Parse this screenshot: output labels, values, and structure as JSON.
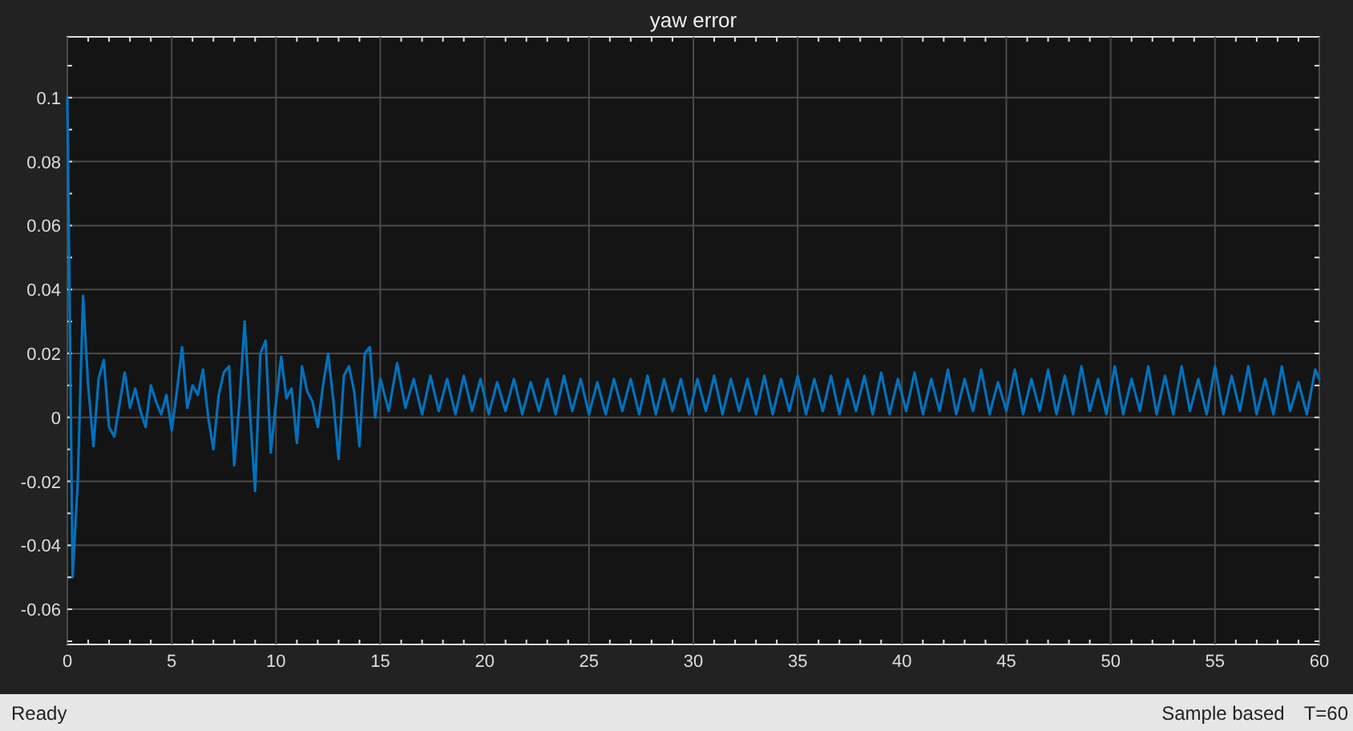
{
  "chart_data": {
    "type": "line",
    "title": "yaw error",
    "grid": true,
    "xlim": [
      0,
      60
    ],
    "ylim": [
      -0.071,
      0.119
    ],
    "xticks": [
      0,
      5,
      10,
      15,
      20,
      25,
      30,
      35,
      40,
      45,
      50,
      55,
      60
    ],
    "yticks": [
      -0.06,
      -0.04,
      -0.02,
      0,
      0.02,
      0.04,
      0.06,
      0.08,
      0.1
    ],
    "x": [
      0,
      0.25,
      0.5,
      0.75,
      1,
      1.25,
      1.5,
      1.75,
      2,
      2.25,
      2.5,
      2.75,
      3,
      3.25,
      3.5,
      3.75,
      4,
      4.25,
      4.5,
      4.75,
      5,
      5.25,
      5.5,
      5.75,
      6,
      6.25,
      6.5,
      6.75,
      7,
      7.25,
      7.5,
      7.75,
      8,
      8.25,
      8.5,
      8.75,
      9,
      9.25,
      9.5,
      9.75,
      10,
      10.25,
      10.5,
      10.75,
      11,
      11.25,
      11.5,
      11.75,
      12,
      12.25,
      12.5,
      12.75,
      13,
      13.25,
      13.5,
      13.75,
      14,
      14.25,
      14.5,
      14.75,
      15,
      15.4,
      15.8,
      16.2,
      16.6,
      17,
      17.4,
      17.8,
      18.2,
      18.6,
      19,
      19.4,
      19.8,
      20.2,
      20.6,
      21,
      21.4,
      21.8,
      22.2,
      22.6,
      23,
      23.4,
      23.8,
      24.2,
      24.6,
      25,
      25.4,
      25.8,
      26.2,
      26.6,
      27,
      27.4,
      27.8,
      28.2,
      28.6,
      29,
      29.4,
      29.8,
      30.2,
      30.6,
      31,
      31.4,
      31.8,
      32.2,
      32.6,
      33,
      33.4,
      33.8,
      34.2,
      34.6,
      35,
      35.4,
      35.8,
      36.2,
      36.6,
      37,
      37.4,
      37.8,
      38.2,
      38.6,
      39,
      39.4,
      39.8,
      40.2,
      40.6,
      41,
      41.4,
      41.8,
      42.2,
      42.6,
      43,
      43.4,
      43.8,
      44.2,
      44.6,
      45,
      45.4,
      45.8,
      46.2,
      46.6,
      47,
      47.4,
      47.8,
      48.2,
      48.6,
      49,
      49.4,
      49.8,
      50.2,
      50.6,
      51,
      51.4,
      51.8,
      52.2,
      52.6,
      53,
      53.4,
      53.8,
      54.2,
      54.6,
      55,
      55.4,
      55.8,
      56.2,
      56.6,
      57,
      57.4,
      57.8,
      58.2,
      58.6,
      59,
      59.4,
      59.8,
      60
    ],
    "series": [
      {
        "color": "#0072bd",
        "values": [
          0.1,
          -0.05,
          -0.02,
          0.038,
          0.01,
          -0.009,
          0.012,
          0.018,
          -0.003,
          -0.006,
          0.004,
          0.014,
          0.003,
          0.009,
          0.002,
          -0.003,
          0.01,
          0.005,
          0.001,
          0.007,
          -0.004,
          0.008,
          0.022,
          0.003,
          0.01,
          0.007,
          0.015,
          0,
          -0.01,
          0.007,
          0.014,
          0.016,
          -0.015,
          0.005,
          0.03,
          0.002,
          -0.023,
          0.02,
          0.024,
          -0.011,
          0.005,
          0.019,
          0.006,
          0.009,
          -0.008,
          0.016,
          0.008,
          0.005,
          -0.003,
          0.01,
          0.02,
          0.005,
          -0.013,
          0.013,
          0.016,
          0.008,
          -0.009,
          0.02,
          0.022,
          0,
          0.012,
          0.002,
          0.017,
          0.003,
          0.012,
          0.001,
          0.013,
          0.002,
          0.012,
          0.001,
          0.013,
          0.002,
          0.012,
          0.001,
          0.011,
          0.002,
          0.012,
          0.001,
          0.011,
          0.002,
          0.012,
          0.001,
          0.013,
          0.002,
          0.012,
          0.001,
          0.011,
          0.001,
          0.012,
          0.002,
          0.012,
          0.001,
          0.013,
          0.001,
          0.012,
          0.002,
          0.012,
          0.001,
          0.012,
          0.002,
          0.013,
          0.001,
          0.012,
          0.002,
          0.012,
          0.001,
          0.013,
          0.001,
          0.012,
          0.002,
          0.013,
          0.001,
          0.012,
          0.002,
          0.013,
          0.001,
          0.012,
          0.002,
          0.013,
          0.001,
          0.014,
          0.001,
          0.012,
          0.002,
          0.014,
          0.001,
          0.012,
          0.002,
          0.015,
          0.001,
          0.012,
          0.002,
          0.015,
          0.001,
          0.011,
          0.002,
          0.015,
          0.001,
          0.012,
          0.002,
          0.015,
          0.001,
          0.013,
          0.001,
          0.016,
          0.002,
          0.012,
          0.001,
          0.016,
          0.001,
          0.012,
          0.002,
          0.016,
          0.001,
          0.013,
          0.001,
          0.016,
          0.002,
          0.012,
          0.001,
          0.016,
          0.001,
          0.013,
          0.002,
          0.016,
          0.001,
          0.012,
          0.001,
          0.016,
          0.002,
          0.011,
          0.001,
          0.015,
          0.012
        ]
      }
    ]
  },
  "status_bar": {
    "message": "Ready",
    "mode": "Sample based",
    "time": "T=60"
  }
}
